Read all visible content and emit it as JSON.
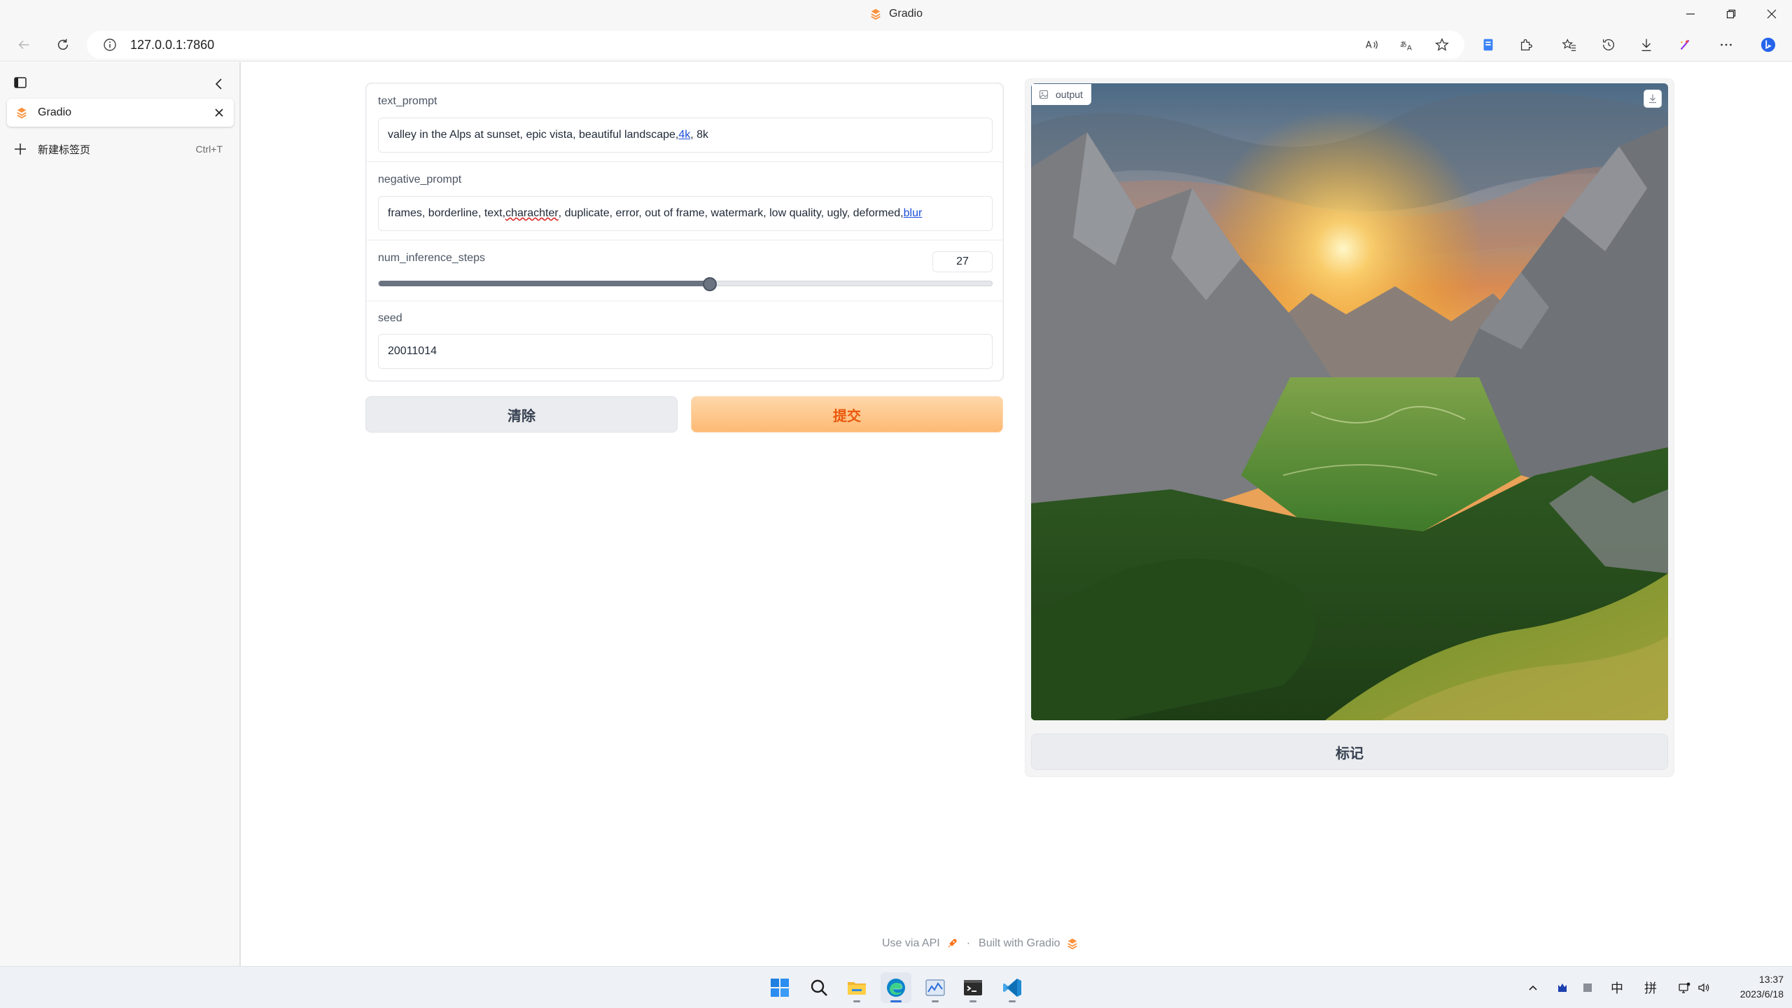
{
  "browser": {
    "window_title": "Gradio",
    "url": "127.0.0.1:7860",
    "tabs": [
      {
        "label": "Gradio",
        "active": true
      }
    ],
    "new_tab": {
      "label": "新建标签页",
      "shortcut": "Ctrl+T"
    },
    "toolbar_icons": [
      "read-aloud-icon",
      "translate-icon",
      "favorite-star-icon",
      "pdf-icon",
      "extensions-icon",
      "favorites-icon",
      "history-icon",
      "downloads-icon",
      "ai-tool-icon",
      "more-icon",
      "bing-icon"
    ]
  },
  "form": {
    "text_prompt": {
      "label": "text_prompt",
      "segments": [
        {
          "text": "valley in the Alps at sunset, epic vista, beautiful landscape,",
          "style": "plain"
        },
        {
          "text": " 4k",
          "style": "link"
        },
        {
          "text": ", 8k",
          "style": "plain"
        }
      ]
    },
    "negative_prompt": {
      "label": "negative_prompt",
      "segments": [
        {
          "text": "frames, borderline, text, ",
          "style": "plain"
        },
        {
          "text": "charachter",
          "style": "misspelled"
        },
        {
          "text": ", duplicate, error, out of frame, watermark, low quality, ugly, deformed, ",
          "style": "plain"
        },
        {
          "text": "blur",
          "style": "link"
        }
      ]
    },
    "num_inference_steps": {
      "label": "num_inference_steps",
      "value": "27",
      "slider_fraction": 0.54
    },
    "seed": {
      "label": "seed",
      "value": "20011014"
    }
  },
  "buttons": {
    "clear": "清除",
    "submit": "提交",
    "flag": "标记"
  },
  "output": {
    "label": "output",
    "image": "alpine-valley-at-sunset"
  },
  "footer": {
    "api": "Use via API",
    "separator": "·",
    "built": "Built with Gradio"
  },
  "taskbar": {
    "apps": [
      "windows-start-icon",
      "search-icon",
      "file-explorer-icon",
      "edge-browser-icon",
      "task-manager-icon",
      "terminal-icon",
      "vscode-icon"
    ],
    "tray": {
      "ime_lang": "中",
      "ime_mode": "拼"
    },
    "time": "13:37",
    "date": "2023/6/18"
  },
  "colors": {
    "accent_orange": "#ea580c",
    "submit_bg": "#fdba74",
    "link_blue": "#1d4ed8"
  }
}
